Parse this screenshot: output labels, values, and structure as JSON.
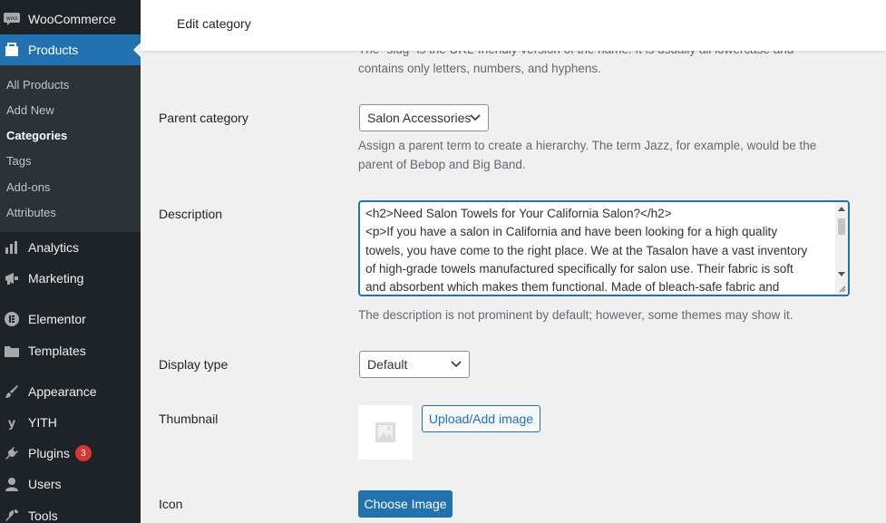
{
  "sidebar": {
    "brand": "WooCommerce",
    "products": "Products",
    "submenu": [
      "All Products",
      "Add New",
      "Categories",
      "Tags",
      "Add-ons",
      "Attributes"
    ],
    "analytics": "Analytics",
    "marketing": "Marketing",
    "elementor": "Elementor",
    "templates": "Templates",
    "appearance": "Appearance",
    "yith": "YITH",
    "plugins": "Plugins",
    "plugins_badge": "3",
    "users": "Users",
    "tools": "Tools"
  },
  "header": {
    "title": "Edit category"
  },
  "form": {
    "slug_help_clipped": "The “slug” is the URL-friendly version of the name. It is usually all lowercase and",
    "slug_help_line2": "contains only letters, numbers, and hyphens.",
    "parent_label": "Parent category",
    "parent_value": "Salon Accessories",
    "parent_help_1": "Assign a parent term to create a hierarchy. The term Jazz, for example, would be the",
    "parent_help_2": "parent of Bebop and Big Band.",
    "description_label": "Description",
    "description_value": "<h2>Need Salon Towels for Your California Salon?</h2>\n<p>If you have a salon in California and have been looking for a high quality\ntowels, you have come to the right place. We at the Tasalon have a vast inventory\nof high-grade towels manufactured specifically for salon use. Their fabric is soft\nand absorbent which makes them functional. Made of bleach-safe fabric and",
    "description_help": "The description is not prominent by default; however, some themes may show it.",
    "display_label": "Display type",
    "display_value": "Default",
    "thumbnail_label": "Thumbnail",
    "upload_button": "Upload/Add image",
    "icon_label": "Icon",
    "choose_image_button": "Choose Image"
  }
}
